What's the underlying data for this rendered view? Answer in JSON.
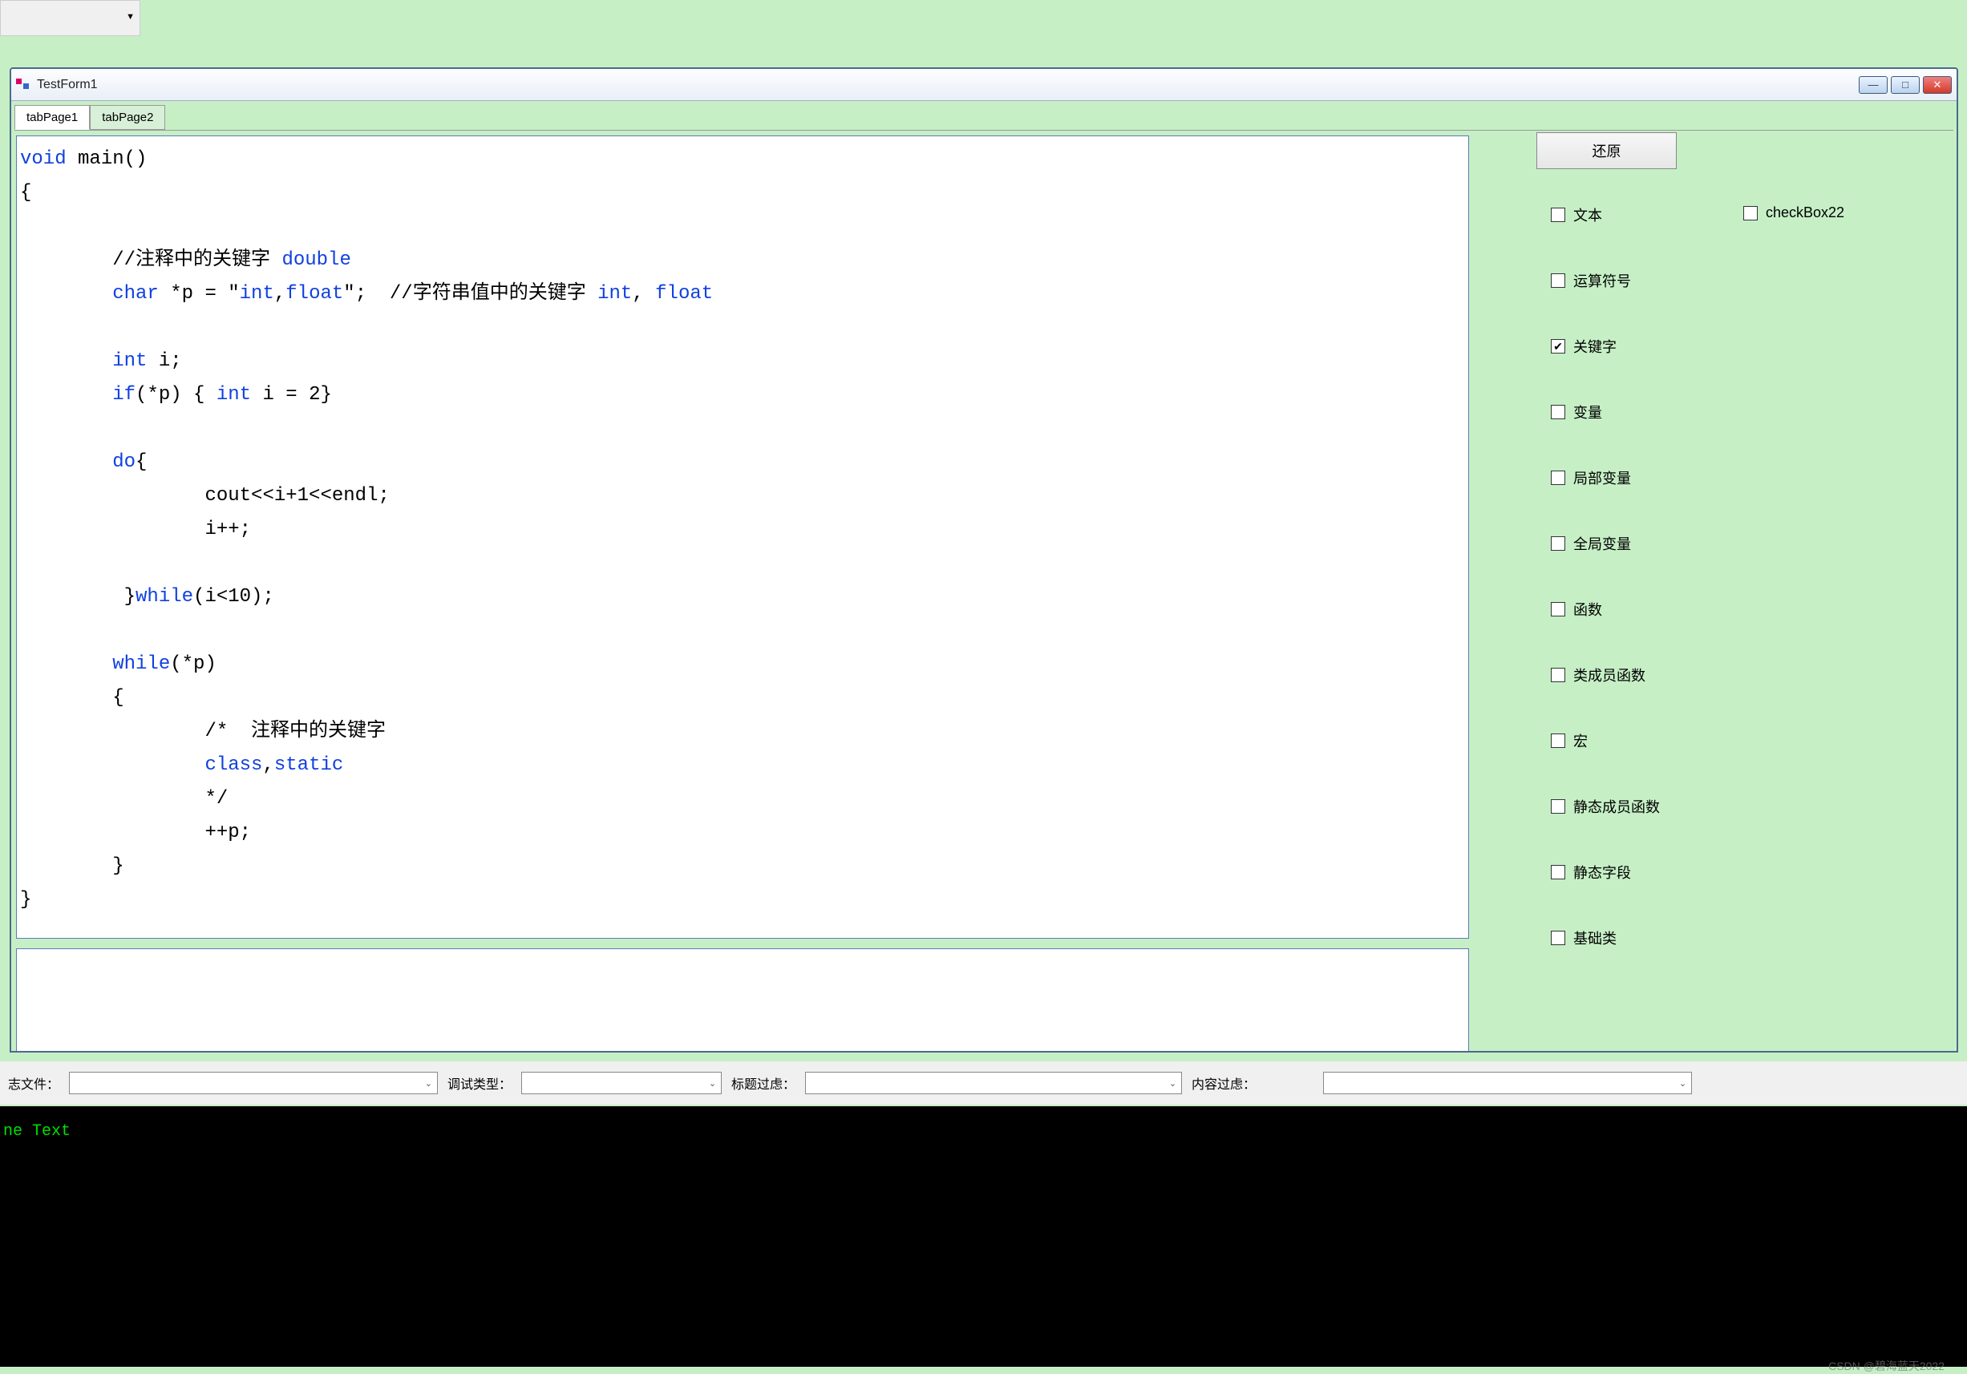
{
  "window": {
    "title": "TestForm1",
    "tabs": [
      "tabPage1",
      "tabPage2"
    ],
    "active_tab": 0
  },
  "code_tokens": [
    {
      "t": "void",
      "c": "kw"
    },
    {
      "t": " main()\n"
    },
    {
      "t": "{\n"
    },
    {
      "t": "\n"
    },
    {
      "t": "        //注释中的关键字 "
    },
    {
      "t": "double",
      "c": "kw"
    },
    {
      "t": "\n"
    },
    {
      "t": "        "
    },
    {
      "t": "char",
      "c": "kw"
    },
    {
      "t": " *p = \""
    },
    {
      "t": "int",
      "c": "kw"
    },
    {
      "t": ","
    },
    {
      "t": "float",
      "c": "kw"
    },
    {
      "t": "\";  //字符串值中的关键字 "
    },
    {
      "t": "int",
      "c": "kw"
    },
    {
      "t": ", "
    },
    {
      "t": "float",
      "c": "kw"
    },
    {
      "t": "\n"
    },
    {
      "t": "\n"
    },
    {
      "t": "        "
    },
    {
      "t": "int",
      "c": "kw"
    },
    {
      "t": " i;\n"
    },
    {
      "t": "        "
    },
    {
      "t": "if",
      "c": "kw"
    },
    {
      "t": "(*p) { "
    },
    {
      "t": "int",
      "c": "kw"
    },
    {
      "t": " i = 2}\n"
    },
    {
      "t": "\n"
    },
    {
      "t": "        "
    },
    {
      "t": "do",
      "c": "kw"
    },
    {
      "t": "{\n"
    },
    {
      "t": "                cout<<i+1<<endl;\n"
    },
    {
      "t": "                i++;\n"
    },
    {
      "t": "\n"
    },
    {
      "t": "         }"
    },
    {
      "t": "while",
      "c": "kw"
    },
    {
      "t": "(i<10);\n"
    },
    {
      "t": "\n"
    },
    {
      "t": "        "
    },
    {
      "t": "while",
      "c": "kw"
    },
    {
      "t": "(*p)\n"
    },
    {
      "t": "        {\n"
    },
    {
      "t": "                /*  注释中的关键字\n"
    },
    {
      "t": "                "
    },
    {
      "t": "class",
      "c": "kw"
    },
    {
      "t": ","
    },
    {
      "t": "static",
      "c": "kw"
    },
    {
      "t": "\n"
    },
    {
      "t": "                */\n"
    },
    {
      "t": "                ++p;\n"
    },
    {
      "t": "        }\n"
    },
    {
      "t": "}"
    }
  ],
  "sidebar": {
    "restore": "还原",
    "checks_col1": [
      {
        "label": "文本",
        "checked": false
      },
      {
        "label": "运算符号",
        "checked": false
      },
      {
        "label": "关键字",
        "checked": true
      },
      {
        "label": "变量",
        "checked": false
      },
      {
        "label": "局部变量",
        "checked": false
      },
      {
        "label": "全局变量",
        "checked": false
      },
      {
        "label": "函数",
        "checked": false
      },
      {
        "label": "类成员函数",
        "checked": false
      },
      {
        "label": "宏",
        "checked": false
      },
      {
        "label": "静态成员函数",
        "checked": false
      },
      {
        "label": "静态字段",
        "checked": false
      },
      {
        "label": "基础类",
        "checked": false
      }
    ],
    "checks_col2": [
      {
        "label": "checkBox22",
        "checked": false
      }
    ]
  },
  "bottom": {
    "label_file": "志文件：",
    "label_debug": "调试类型：",
    "label_title": "标题过虑：",
    "label_content": "内容过虑：",
    "combo_file": "",
    "combo_debug": "",
    "combo_title": "",
    "combo_content": "",
    "combo_right": ""
  },
  "console_text": "ne Text",
  "watermark": "CSDN @碧海蓝天2022"
}
